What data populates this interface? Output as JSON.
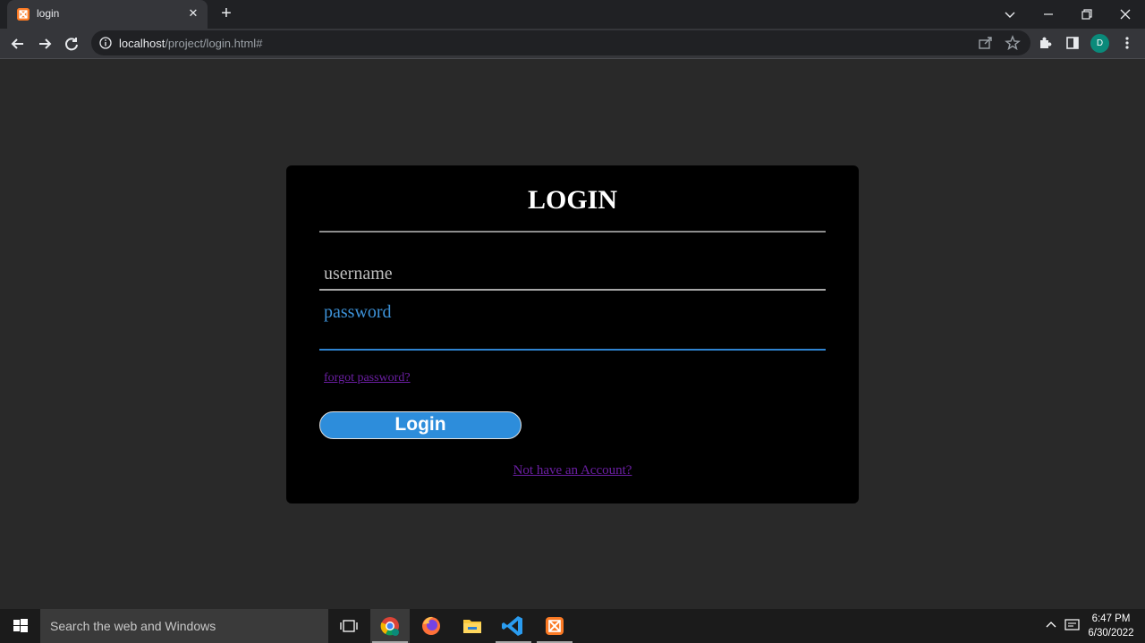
{
  "browser": {
    "tab_title": "login",
    "tab_favicon_text": "⌘",
    "new_tab": "+",
    "url_host": "localhost",
    "url_path": "/project/login.html#",
    "profile_initial": "D",
    "window_controls": {
      "tabsearch": "⌄",
      "minimize": "–",
      "restore": "❐",
      "close": "✕"
    },
    "tab_close": "✕"
  },
  "page": {
    "title": "LOGIN",
    "username_placeholder": "username",
    "password_placeholder": "password",
    "forgot_link": "forgot password?",
    "login_button": "Login",
    "signup_link": "Not have an Account?"
  },
  "taskbar": {
    "search_placeholder": "Search the web and Windows",
    "time": "6:47 PM",
    "date": "6/30/2022"
  },
  "colors": {
    "page_bg": "#292929",
    "card_bg": "#000000",
    "accent_blue": "#2d8ddb",
    "link_purple": "#6b1fa3"
  }
}
